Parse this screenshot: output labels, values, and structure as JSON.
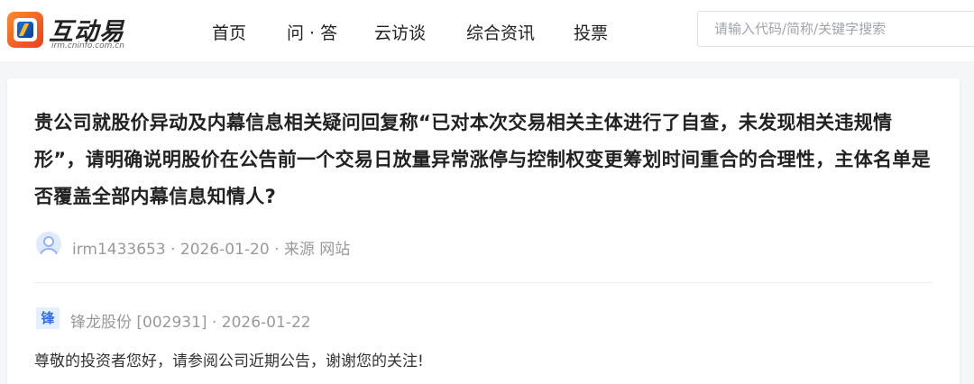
{
  "header": {
    "logo_text": "互动易",
    "logo_subtext": "irm.cninfo.com.cn",
    "nav": [
      "首页",
      "问 · 答",
      "云访谈",
      "综合资讯",
      "投票"
    ],
    "search_placeholder": "请输入代码/简称/关键字搜索"
  },
  "question": {
    "text": "贵公司就股价异动及内幕信息相关疑问回复称“已对本次交易相关主体进行了自查，未发现相关违规情形”，请明确说明股价在公告前一个交易日放量异常涨停与控制权变更筹划时间重合的合理性，主体名单是否覆盖全部内幕信息知情人?",
    "meta": "irm1433653 · 2026-01-20 · 来源 网站"
  },
  "answer": {
    "badge": "锋",
    "meta": "锋龙股份 [002931] · 2026-01-22",
    "text": "尊敬的投资者您好，请参阅公司近期公告，谢谢您的关注!"
  },
  "colors": {
    "accent_blue": "#2f6fe4",
    "logo_orange": "#e8401c",
    "page_bg": "#f5f6f8"
  }
}
